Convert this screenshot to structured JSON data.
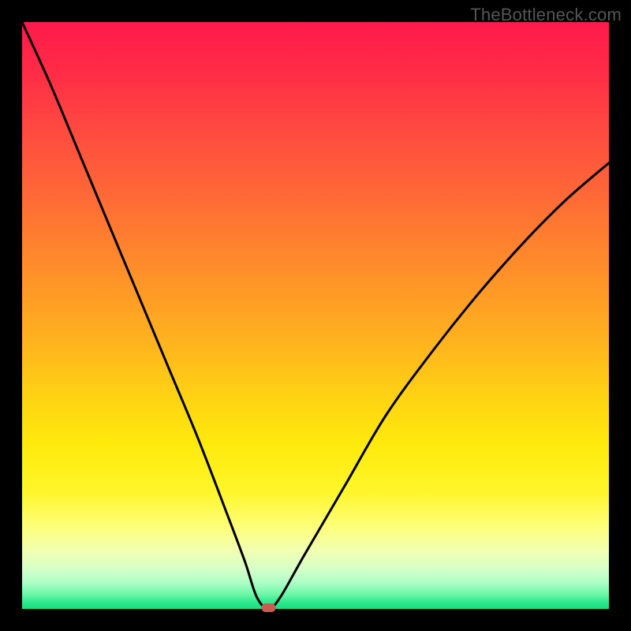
{
  "watermark": "TheBottleneck.com",
  "chart_data": {
    "type": "line",
    "title": "",
    "xlabel": "",
    "ylabel": "",
    "xlim": [
      0,
      1
    ],
    "ylim": [
      0,
      100
    ],
    "series": [
      {
        "name": "bottleneck-curve",
        "x": [
          0.0,
          0.05,
          0.1,
          0.15,
          0.2,
          0.25,
          0.3,
          0.35,
          0.38,
          0.4,
          0.42,
          0.44,
          0.48,
          0.55,
          0.62,
          0.7,
          0.78,
          0.86,
          0.93,
          1.0
        ],
        "values": [
          100,
          89,
          77,
          65,
          53,
          41,
          29,
          16,
          8,
          2,
          0,
          2,
          9,
          21,
          33,
          44,
          54,
          63,
          70,
          76
        ]
      }
    ],
    "minimum_marker": {
      "x": 0.42,
      "y": 0
    },
    "background_gradient": {
      "top": "#ff1a4b",
      "mid": "#ffea0c",
      "bottom": "#16e07e"
    }
  }
}
